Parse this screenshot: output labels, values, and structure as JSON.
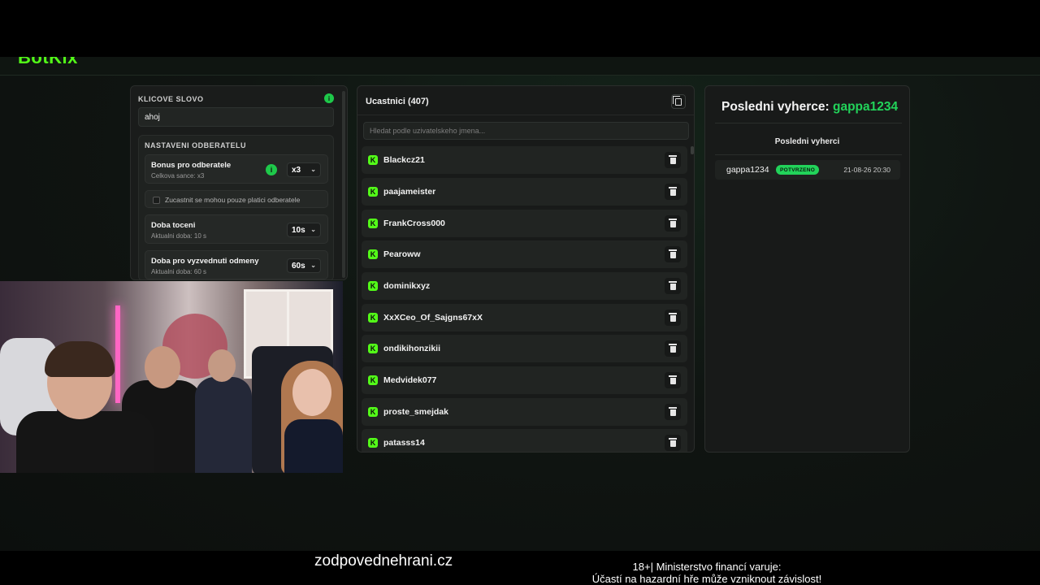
{
  "app": {
    "brand": "BotKix",
    "accent_color": "#53fc18",
    "success_color": "#22d35a"
  },
  "settings_panel": {
    "keyword_label": "KLICOVE SLOVO",
    "keyword_info_icon": "i",
    "keyword_value": "ahoj",
    "subscriber_section_title": "NASTAVENI ODBERATELU",
    "subscriber_bonus": {
      "title": "Bonus pro odberatele",
      "subtitle": "Celkova sance: x3",
      "info_icon": "i",
      "value": "x3"
    },
    "paid_only_checkbox": {
      "label": "Zucastnit se mohou pouze platici odberatele",
      "checked": false
    },
    "spin_duration": {
      "title": "Doba toceni",
      "subtitle": "Aktualni doba: 10 s",
      "value": "10s"
    },
    "claim_duration": {
      "title": "Doba pro vyzvednuti odmeny",
      "subtitle": "Aktualni doba: 60 s",
      "value": "60s"
    }
  },
  "participants": {
    "title": "Ucastnici (407)",
    "search_placeholder": "Hledat podle uzivatelskeho jmena...",
    "platform_icon": "K",
    "list": [
      {
        "name": "Blackcz21"
      },
      {
        "name": "paajameister"
      },
      {
        "name": "FrankCross000"
      },
      {
        "name": "Pearoww"
      },
      {
        "name": "dominikxyz"
      },
      {
        "name": "XxXCeo_Of_Sajgns67xX"
      },
      {
        "name": "ondikihonzikii"
      },
      {
        "name": "Medvidek077"
      },
      {
        "name": "proste_smejdak"
      },
      {
        "name": "patasss14"
      }
    ]
  },
  "winner_panel": {
    "heading_prefix": "Posledni vyherce: ",
    "winner_name": "gappa1234",
    "recent_title": "Posledni vyherci",
    "recent": [
      {
        "name": "gappa1234",
        "status": "POTVRZENO",
        "date": "21-08-26 20:30"
      }
    ]
  },
  "footer": {
    "site": "zodpovednehrani.cz",
    "warning_line1": "18+| Ministerstvo financí varuje:",
    "warning_line2": "Účastí na hazardní hře může vzniknout závislost!"
  }
}
